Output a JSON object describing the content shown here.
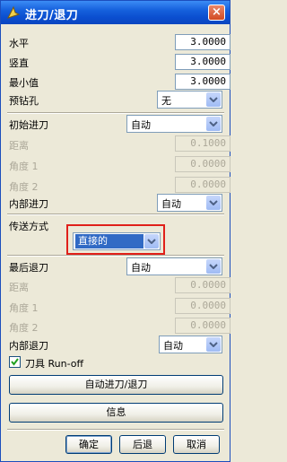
{
  "window": {
    "title": "进刀/退刀",
    "close_glyph": "×"
  },
  "fields": {
    "horizontal": {
      "label": "水平",
      "value": "3.0000"
    },
    "vertical": {
      "label": "竖直",
      "value": "3.0000"
    },
    "minimum": {
      "label": "最小值",
      "value": "3.0000"
    },
    "predrill": {
      "label": "预钻孔",
      "value": "无"
    }
  },
  "initial_engage": {
    "label": "初始进刀",
    "value": "自动",
    "distance": {
      "label": "距离",
      "value": "0.1000"
    },
    "angle1": {
      "label": "角度 1",
      "value": "0.0000"
    },
    "angle2": {
      "label": "角度 2",
      "value": "0.0000"
    }
  },
  "internal_engage": {
    "label": "内部进刀",
    "value": "自动"
  },
  "transfer": {
    "label": "传送方式",
    "value": "直接的"
  },
  "final_retract": {
    "label": "最后退刀",
    "value": "自动",
    "distance": {
      "label": "距离",
      "value": "0.0000"
    },
    "angle1": {
      "label": "角度 1",
      "value": "0.0000"
    },
    "angle2": {
      "label": "角度 2",
      "value": "0.0000"
    }
  },
  "internal_retract": {
    "label": "内部退刀",
    "value": "自动"
  },
  "tool_runoff": {
    "label": "刀具 Run-off",
    "checked": true
  },
  "buttons": {
    "auto": "自动进刀/退刀",
    "info": "信息",
    "ok": "确定",
    "back": "后退",
    "cancel": "取消"
  },
  "colors": {
    "title_bar": "#0b4fd0",
    "highlight": "#e0201a",
    "selection": "#316ac5"
  }
}
